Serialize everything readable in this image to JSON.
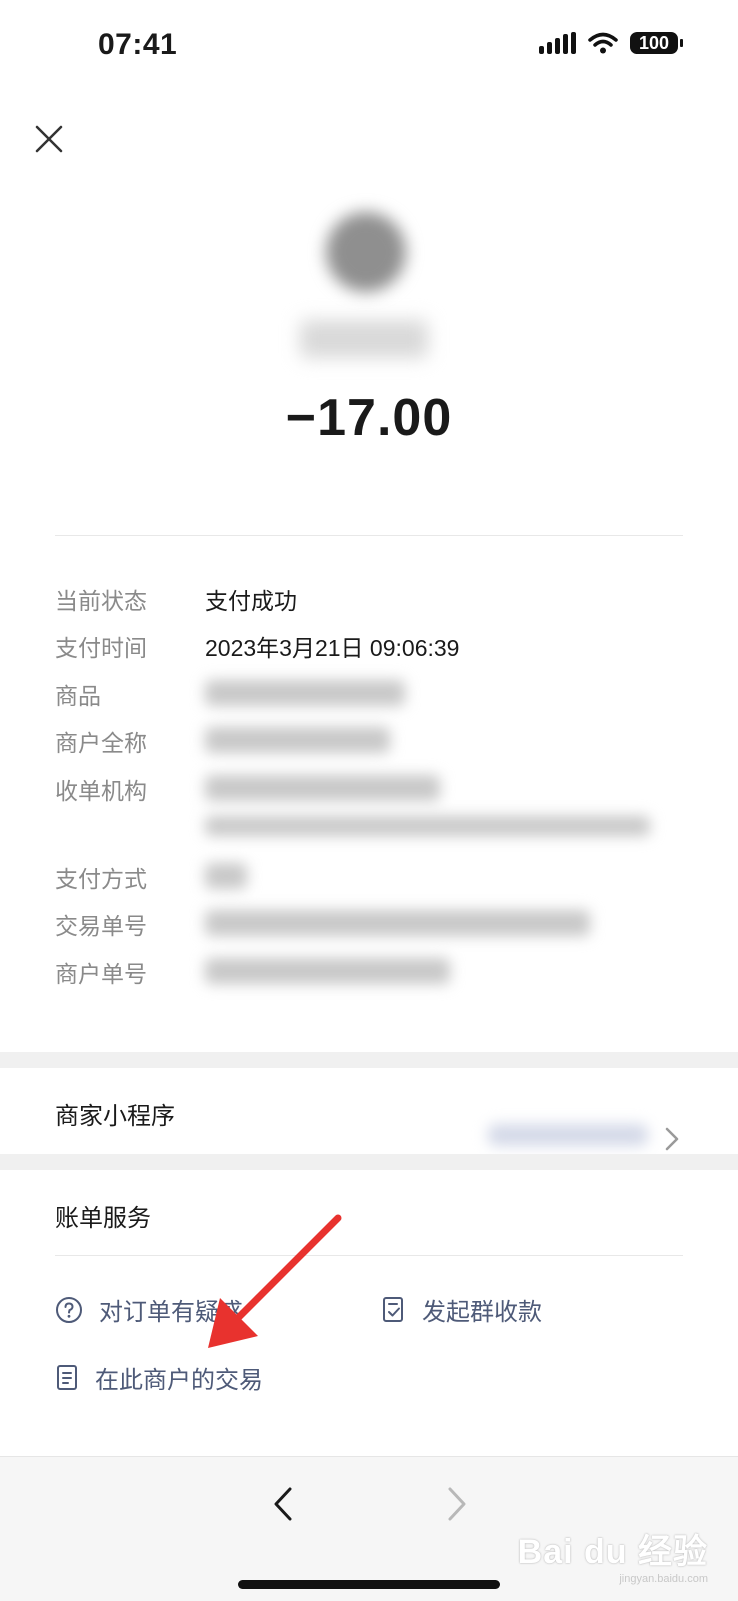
{
  "status_bar": {
    "time": "07:41",
    "battery": "100"
  },
  "header": {
    "amount": "−17.00"
  },
  "details": {
    "status_label": "当前状态",
    "status_value": "支付成功",
    "time_label": "支付时间",
    "time_value": "2023年3月21日 09:06:39",
    "goods_label": "商品",
    "merchant_label": "商户全称",
    "acquirer_label": "收单机构",
    "method_label": "支付方式",
    "txn_label": "交易单号",
    "merchant_no_label": "商户单号"
  },
  "mini_program": {
    "label": "商家小程序"
  },
  "bill_services": {
    "title": "账单服务",
    "question": "对订单有疑惑",
    "group_collect": "发起群收款",
    "merchant_trades": "在此商户的交易"
  },
  "watermark": {
    "text": "Bai du 经验",
    "sub": "jingyan.baidu.com"
  },
  "colors": {
    "accent": "#4e5a78",
    "annotation_arrow": "#e8322e"
  }
}
